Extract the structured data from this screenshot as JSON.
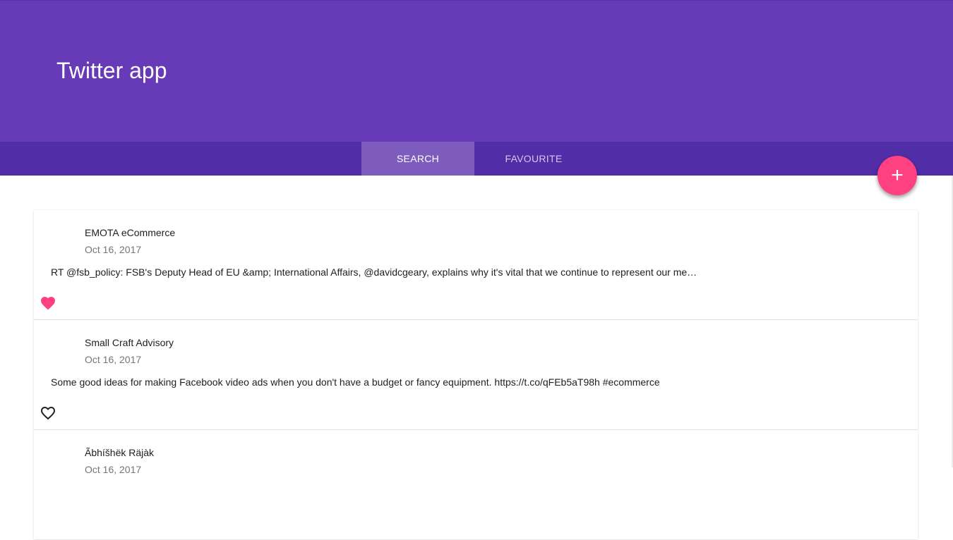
{
  "header": {
    "title": "Twitter app",
    "color": "#673ab7"
  },
  "tabs": [
    {
      "label": "SEARCH",
      "active": true
    },
    {
      "label": "FAVOURITE",
      "active": false
    }
  ],
  "fab": {
    "label": "+",
    "icon": "add-icon",
    "color": "#ff4081"
  },
  "tweets": [
    {
      "author": "EMOTA eCommerce",
      "date": "Oct 16, 2017",
      "text": "RT @fsb_policy: FSB's Deputy Head of EU &amp; International Affairs, @davidcgeary, explains why it's vital that we continue to represent our me…",
      "favourited": true
    },
    {
      "author": "Small Craft Advisory",
      "date": "Oct 16, 2017",
      "text": "Some good ideas for making Facebook video ads when you don't have a budget or fancy equipment. https://t.co/qFEb5aT98h #ecommerce",
      "favourited": false
    },
    {
      "author": "Ãbhíšhëk Räjàk",
      "date": "Oct 16, 2017",
      "text": "",
      "favourited": false
    }
  ]
}
